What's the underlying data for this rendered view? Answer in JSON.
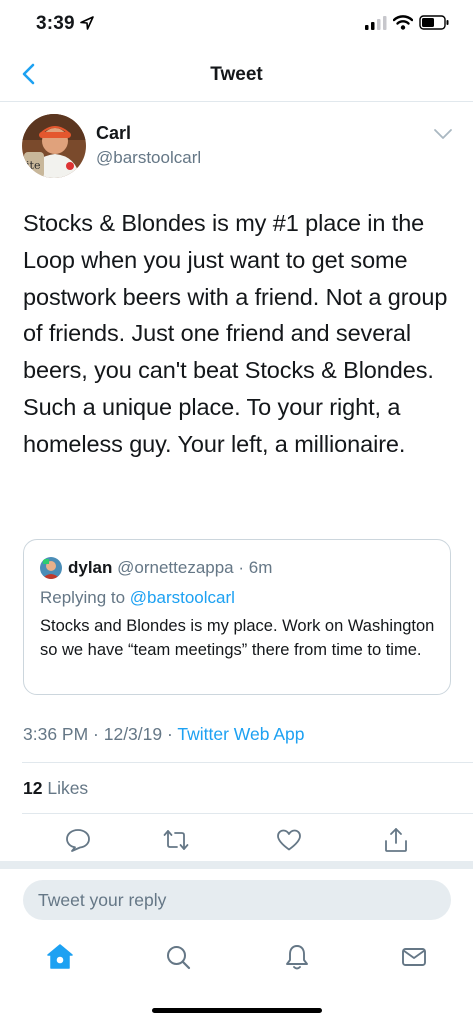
{
  "status_bar": {
    "time": "3:39"
  },
  "nav": {
    "title": "Tweet"
  },
  "tweet": {
    "author_name": "Carl",
    "author_handle": "@barstoolcarl",
    "text": "Stocks & Blondes is my #1 place in the Loop when you just want to get some postwork beers with a friend. Not a group of friends. Just one friend and several beers, you can't beat Stocks & Blondes. Such a unique place. To your right, a homeless guy. Your left, a millionaire.",
    "timestamp": "3:36 PM · 12/3/19 · ",
    "source": "Twitter Web App",
    "likes_count": "12",
    "likes_label": " Likes"
  },
  "quote": {
    "name": "dylan",
    "handle_time": " @ornettezappa · 6m",
    "replying_prefix": "Replying to ",
    "replying_to": "@barstoolcarl",
    "text": "Stocks and Blondes is my place. Work on Washington so we have “team meetings” there from time to time."
  },
  "reply": {
    "placeholder": "Tweet your reply"
  },
  "colors": {
    "accent": "#1da1f2",
    "secondary_text": "#657786",
    "border": "#e1e8ed"
  }
}
